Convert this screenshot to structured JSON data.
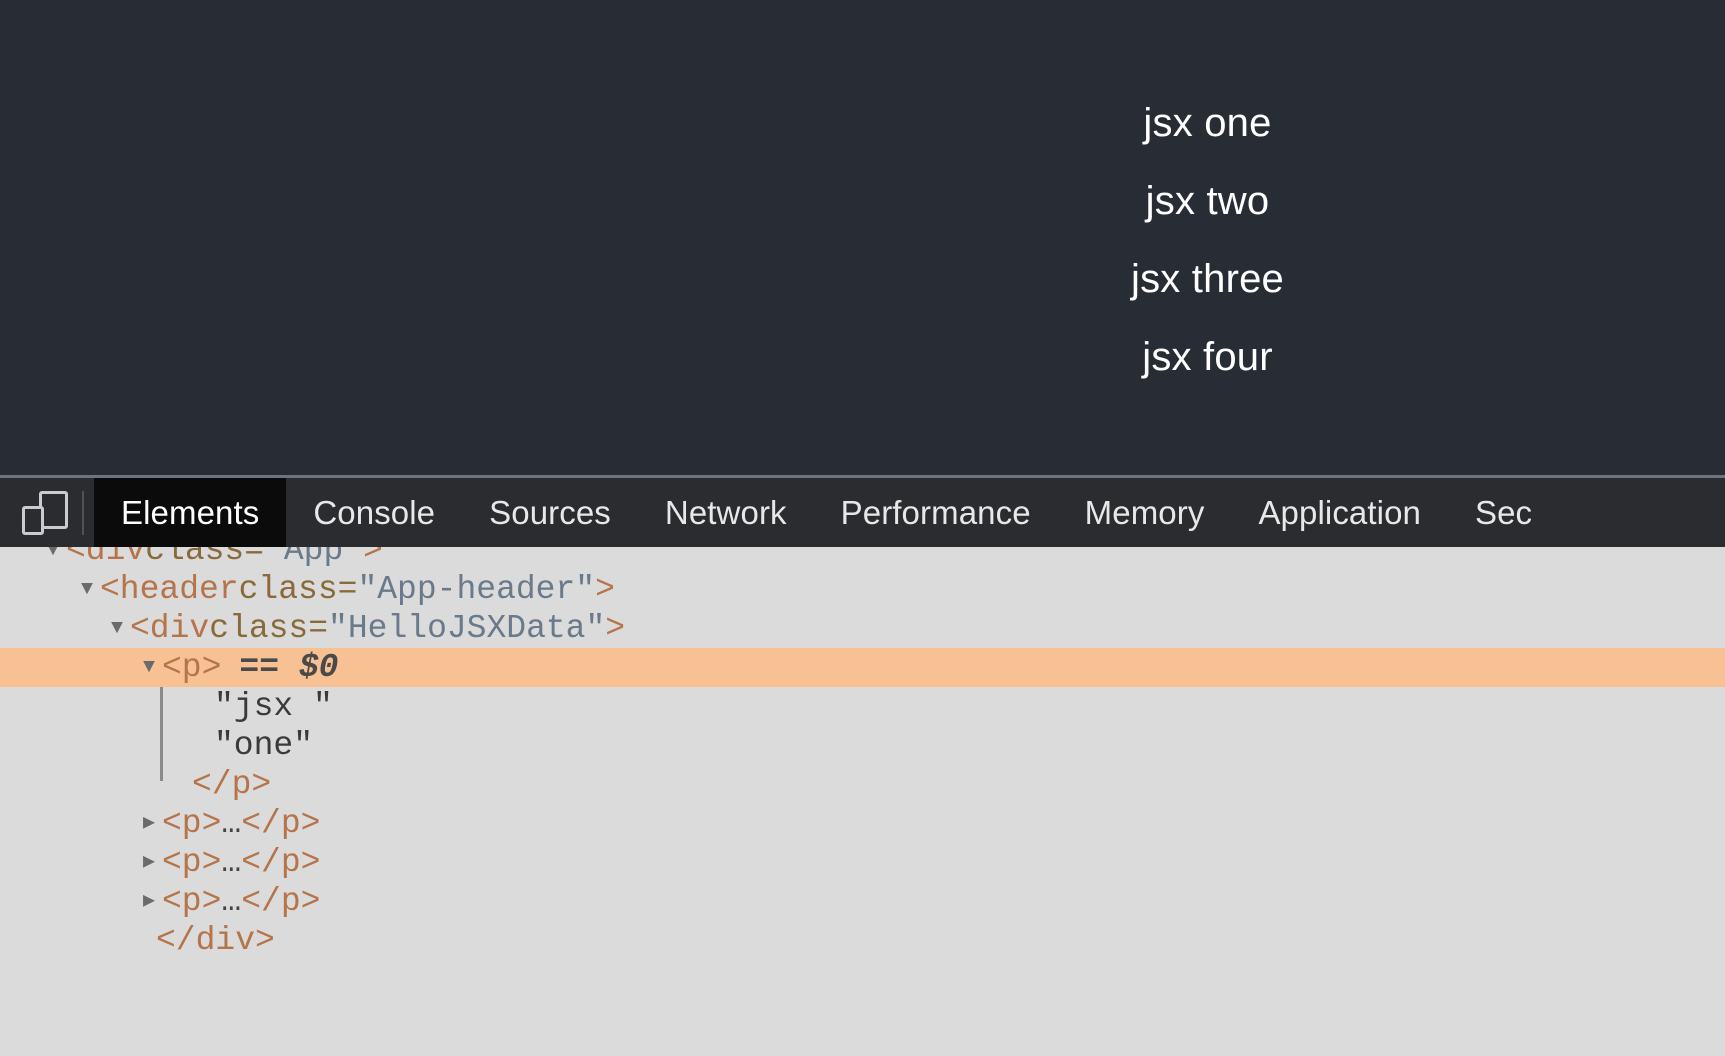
{
  "app": {
    "background_color": "#282c34",
    "jsx_lines": [
      {
        "text": "jsx one"
      },
      {
        "text": "jsx two"
      },
      {
        "text": "jsx three"
      },
      {
        "text": "jsx four"
      }
    ]
  },
  "devtools": {
    "device_toolbar_icon": "device-toolbar-icon",
    "active_tab": "Elements",
    "tabs": [
      {
        "label": "Elements",
        "active": true
      },
      {
        "label": "Console",
        "active": false
      },
      {
        "label": "Sources",
        "active": false
      },
      {
        "label": "Network",
        "active": false
      },
      {
        "label": "Performance",
        "active": false
      },
      {
        "label": "Memory",
        "active": false
      },
      {
        "label": "Application",
        "active": false
      },
      {
        "label": "Sec",
        "active": false
      }
    ],
    "accent_selected_row": "#f8c194",
    "panel_background": "#dbdbdb",
    "toolbar_background": "#2a2c2f"
  },
  "dom_tree": {
    "rows": [
      {
        "id": "row-div-app",
        "twisty": "down",
        "indent": 40,
        "selected": false,
        "open_tag": "<div",
        "attr_name": " class=",
        "attr_value": "\"App\"",
        "close_bracket": ">",
        "text": "",
        "kind": "element-open"
      },
      {
        "id": "row-header",
        "twisty": "down",
        "indent": 74,
        "selected": false,
        "open_tag": "<header",
        "attr_name": " class=",
        "attr_value": "\"App-header\"",
        "close_bracket": ">",
        "text": "",
        "kind": "element-open"
      },
      {
        "id": "row-div-hellojsxdata",
        "twisty": "down",
        "indent": 104,
        "selected": false,
        "open_tag": "<div",
        "attr_name": " class=",
        "attr_value": "\"HelloJSXData\"",
        "close_bracket": ">",
        "text": "",
        "kind": "element-open"
      },
      {
        "id": "row-p-selected",
        "twisty": "down",
        "indent": 136,
        "selected": true,
        "open_tag": "<p>",
        "attr_name": "",
        "attr_value": "",
        "close_bracket": "",
        "text": "== $0",
        "kind": "element-open-selected"
      },
      {
        "id": "row-text-jsx",
        "twisty": "blank",
        "indent": 188,
        "selected": false,
        "open_tag": "",
        "attr_name": "",
        "attr_value": "",
        "close_bracket": "",
        "text": "\"jsx \"",
        "kind": "text-node"
      },
      {
        "id": "row-text-one",
        "twisty": "blank",
        "indent": 188,
        "selected": false,
        "open_tag": "",
        "attr_name": "",
        "attr_value": "",
        "close_bracket": "",
        "text": "\"one\"",
        "kind": "text-node"
      },
      {
        "id": "row-p-close",
        "twisty": "blank",
        "indent": 166,
        "selected": false,
        "open_tag": "</p>",
        "attr_name": "",
        "attr_value": "",
        "close_bracket": "",
        "text": "",
        "kind": "element-close"
      },
      {
        "id": "row-p-collapsed-2",
        "twisty": "right",
        "indent": 136,
        "selected": false,
        "open_tag": "<p>",
        "attr_name": "",
        "attr_value": "",
        "close_bracket": "</p>",
        "text": "…",
        "kind": "element-collapsed"
      },
      {
        "id": "row-p-collapsed-3",
        "twisty": "right",
        "indent": 136,
        "selected": false,
        "open_tag": "<p>",
        "attr_name": "",
        "attr_value": "",
        "close_bracket": "</p>",
        "text": "…",
        "kind": "element-collapsed"
      },
      {
        "id": "row-p-collapsed-4",
        "twisty": "right",
        "indent": 136,
        "selected": false,
        "open_tag": "<p>",
        "attr_name": "",
        "attr_value": "",
        "close_bracket": "</p>",
        "text": "…",
        "kind": "element-collapsed"
      },
      {
        "id": "row-div-close",
        "twisty": "blank",
        "indent": 130,
        "selected": false,
        "open_tag": "</div>",
        "attr_name": "",
        "attr_value": "",
        "close_bracket": "",
        "text": "",
        "kind": "element-close"
      }
    ]
  }
}
